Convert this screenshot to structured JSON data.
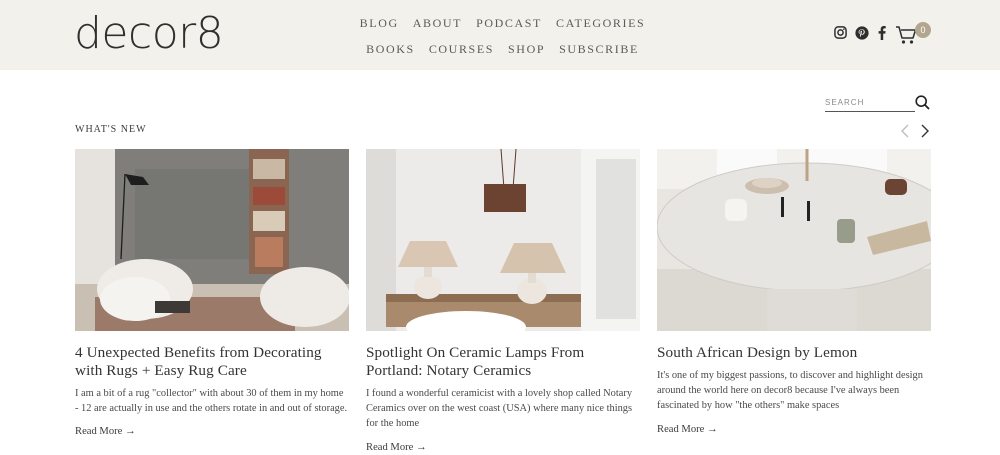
{
  "header": {
    "logo": "decor8",
    "nav_row1": [
      "BLOG",
      "ABOUT",
      "PODCAST",
      "CATEGORIES"
    ],
    "nav_row2": [
      "BOOKS",
      "COURSES",
      "SHOP",
      "SUBSCRIBE"
    ],
    "social_icons": [
      "instagram-icon",
      "pinterest-icon",
      "facebook-icon"
    ],
    "cart_count": "0"
  },
  "search": {
    "placeholder": "SEARCH"
  },
  "section": {
    "title": "WHAT'S NEW"
  },
  "cards": [
    {
      "title": "4 Unexpected Benefits from Decorating with Rugs + Easy Rug Care",
      "excerpt": "I am a bit of a rug \"collector\" with about 30 of them in my home - 12 are actually in use and the others rotate in and out of storage.",
      "read_more": "Read More →"
    },
    {
      "title": "Spotlight On Ceramic Lamps From Portland: Notary Ceramics",
      "excerpt": "I found a wonderful ceramicist with a lovely shop called Notary Ceramics over on the west coast (USA) where many nice things for the home",
      "read_more": "Read More →"
    },
    {
      "title": "South African Design by Lemon",
      "excerpt": "It's one of my biggest passions, to discover and highlight design around the world here on decor8 because I've always been fascinated by how \"the others\" make spaces",
      "read_more": "Read More →"
    }
  ]
}
